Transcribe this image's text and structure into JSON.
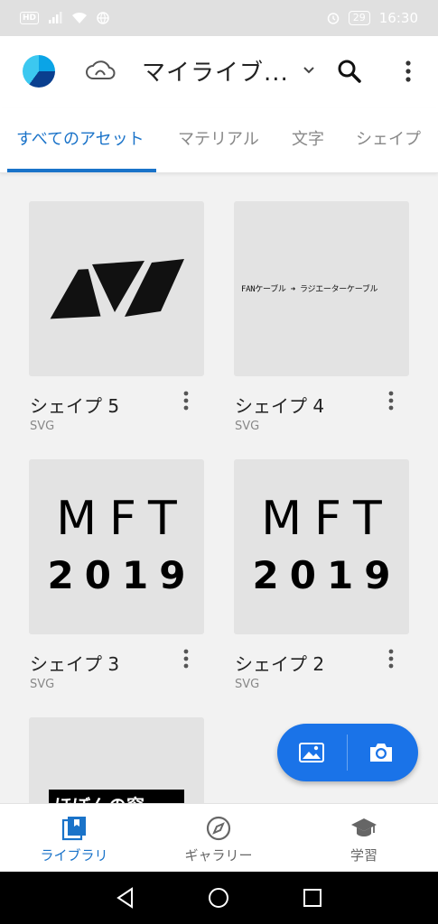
{
  "status_bar": {
    "network_badge": "HD",
    "battery": "29",
    "time": "16:30"
  },
  "header": {
    "library_title": "マイライブ...",
    "icons": [
      "app-logo-icon",
      "creative-cloud-icon",
      "chevron-down-icon",
      "search-icon",
      "more-vert-icon"
    ]
  },
  "tabs": [
    {
      "label": "すべてのアセット",
      "active": true
    },
    {
      "label": "マテリアル",
      "active": false
    },
    {
      "label": "文字",
      "active": false
    },
    {
      "label": "シェイプ",
      "active": false
    }
  ],
  "assets": [
    {
      "name": "シェイプ 5",
      "type": "SVG",
      "thumb": "shape-logo"
    },
    {
      "name": "シェイプ 4",
      "type": "SVG",
      "thumb": "handwritten-fan",
      "thumb_text": "FANケーブル ➜ ラジエーターケーブル"
    },
    {
      "name": "シェイプ 3",
      "type": "SVG",
      "thumb": "mft",
      "thumb_text": [
        "MFT",
        "2019"
      ]
    },
    {
      "name": "シェイプ 2",
      "type": "SVG",
      "thumb": "mft",
      "thumb_text": [
        "MFT",
        "2019"
      ]
    },
    {
      "name": "",
      "type": "",
      "thumb": "partial-banner",
      "thumb_text": "ほぼんの窓"
    }
  ],
  "fab": {
    "image_icon": "image-icon",
    "camera_icon": "camera-icon"
  },
  "bottom_nav": [
    {
      "label": "ライブラリ",
      "icon": "library-icon",
      "active": true
    },
    {
      "label": "ギャラリー",
      "icon": "compass-icon",
      "active": false
    },
    {
      "label": "学習",
      "icon": "graduation-cap-icon",
      "active": false
    }
  ],
  "colors": {
    "accent": "#1a73c9",
    "fab": "#1a73e8",
    "background": "#f2f2f2",
    "thumb_bg": "#e3e3e3"
  }
}
